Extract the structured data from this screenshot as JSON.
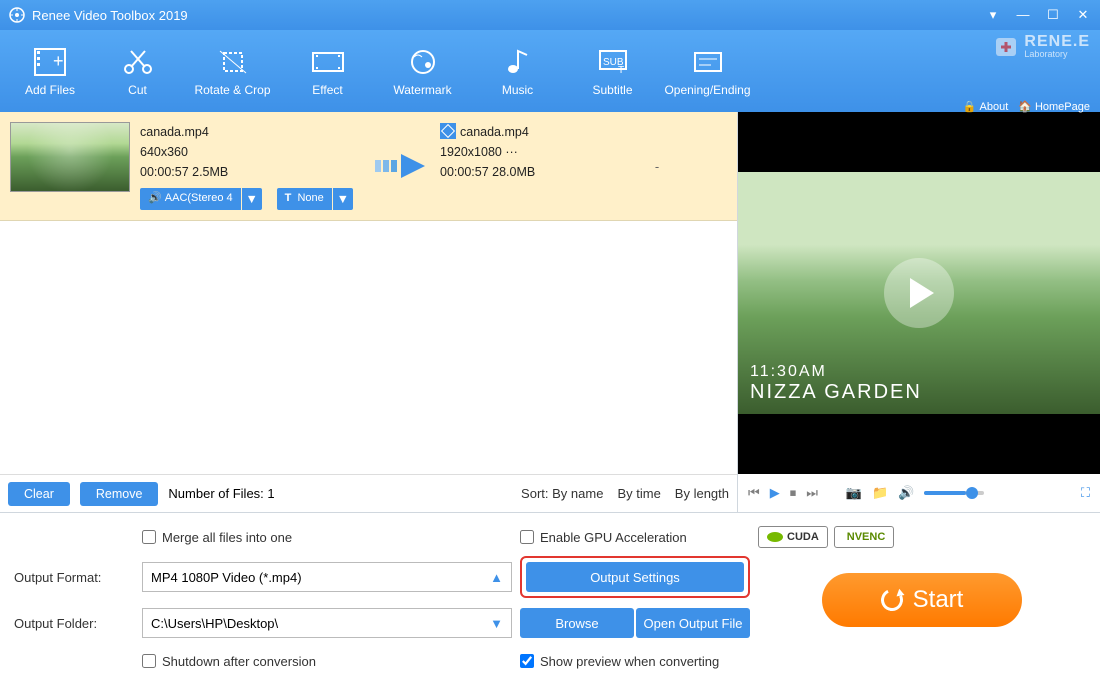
{
  "title": "Renee Video Toolbox 2019",
  "brand": {
    "name": "RENE.E",
    "sub": "Laboratory",
    "about": "About",
    "homepage": "HomePage"
  },
  "toolbar": [
    {
      "k": "add-files",
      "label": "Add Files"
    },
    {
      "k": "cut",
      "label": "Cut"
    },
    {
      "k": "rotate-crop",
      "label": "Rotate & Crop"
    },
    {
      "k": "effect",
      "label": "Effect"
    },
    {
      "k": "watermark",
      "label": "Watermark"
    },
    {
      "k": "music",
      "label": "Music"
    },
    {
      "k": "subtitle",
      "label": "Subtitle"
    },
    {
      "k": "opening-ending",
      "label": "Opening/Ending"
    }
  ],
  "file": {
    "src": {
      "name": "canada.mp4",
      "res": "640x360",
      "dur_size": "00:00:57 2.5MB",
      "audio": "AAC(Stereo 4",
      "sub": "None"
    },
    "dst": {
      "name": "canada.mp4",
      "res": "1920x1080   ···",
      "dur_size": "00:00:57 28.0MB",
      "dash": "-"
    }
  },
  "liststrip": {
    "clear": "Clear",
    "remove": "Remove",
    "count_label": "Number of Files:  1",
    "sort_prefix": "Sort:",
    "by_name": "By name",
    "by_time": "By time",
    "by_length": "By length"
  },
  "preview": {
    "time": "11:30AM",
    "place": "NIZZA GARDEN"
  },
  "settings": {
    "merge": "Merge all files into one",
    "gpu": "Enable GPU Acceleration",
    "cuda": "CUDA",
    "nvenc": "NVENC",
    "output_format_label": "Output Format:",
    "output_format_value": "MP4 1080P Video (*.mp4)",
    "output_settings": "Output Settings",
    "output_folder_label": "Output Folder:",
    "output_folder_value": "C:\\Users\\HP\\Desktop\\",
    "browse": "Browse",
    "open_output": "Open Output File",
    "shutdown": "Shutdown after conversion",
    "show_preview": "Show preview when converting",
    "start": "Start"
  },
  "icon_chips": {
    "audio": "🔊",
    "sub": "T"
  }
}
